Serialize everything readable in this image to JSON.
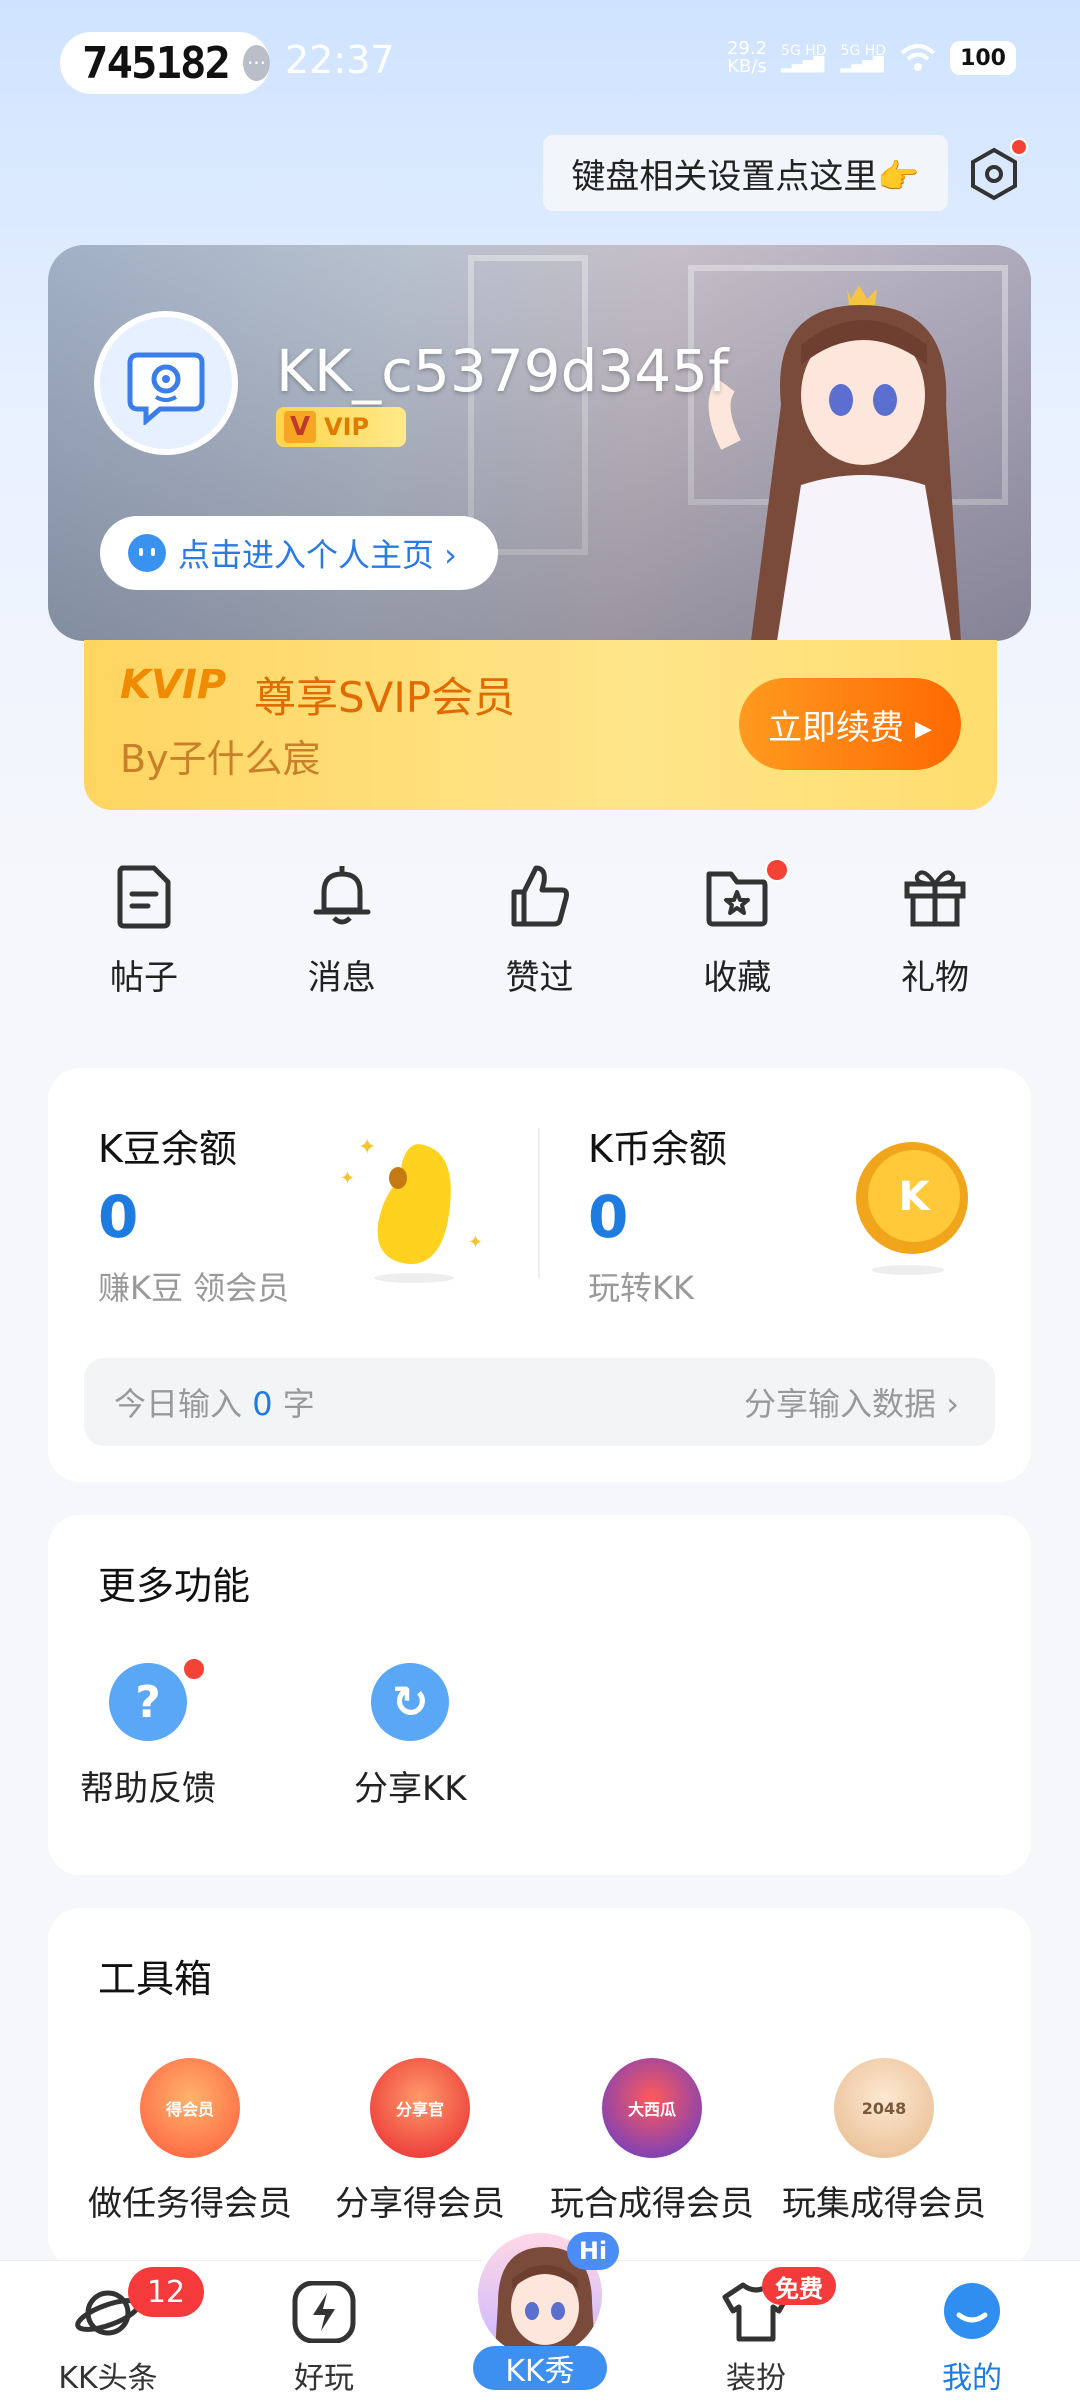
{
  "status_bar": {
    "pill_number": "745182",
    "time": "22:37",
    "net_speed": "29.2",
    "net_unit": "KB/s",
    "sim1": "5G HD",
    "sim2": "5G HD",
    "battery": "100"
  },
  "keyboard_tip": "键盘相关设置点这里👉",
  "profile": {
    "username": "KK_c5379d345f",
    "vip_badge": "VIP",
    "vip_letter": "V",
    "home_button": "点击进入个人主页 ›"
  },
  "svip_banner": {
    "brand": "KVIP",
    "title": "尊享SVIP会员",
    "subtitle": "By子什么宸",
    "renew_button": "立即续费 ▸"
  },
  "quick_actions": [
    {
      "label": "帖子",
      "icon": "post-icon"
    },
    {
      "label": "消息",
      "icon": "bell-icon"
    },
    {
      "label": "赞过",
      "icon": "thumb-up-icon"
    },
    {
      "label": "收藏",
      "icon": "favorite-folder-icon"
    },
    {
      "label": "礼物",
      "icon": "gift-icon"
    }
  ],
  "balance": {
    "kdou_title": "K豆余额",
    "kdou_value": "0",
    "kdou_sub": "赚K豆 领会员",
    "kbi_title": "K币余额",
    "kbi_value": "0",
    "kbi_sub": "玩转KK",
    "kbi_coin": "K",
    "today_prefix": "今日输入",
    "today_count": "0",
    "today_suffix": "字",
    "share_data": "分享输入数据 ›"
  },
  "more_functions": {
    "title": "更多功能",
    "items": [
      {
        "label": "帮助反馈",
        "icon": "help-icon",
        "glyph": "?"
      },
      {
        "label": "分享KK",
        "icon": "share-icon",
        "glyph": "↻"
      }
    ]
  },
  "toolbox": {
    "title": "工具箱",
    "items": [
      {
        "label": "做任务得会员",
        "icon": "task-vip-icon",
        "tag": "得会员",
        "color": "#ff7a4a"
      },
      {
        "label": "分享得会员",
        "icon": "share-vip-icon",
        "tag": "分享官",
        "color": "#ff4d4d"
      },
      {
        "label": "玩合成得会员",
        "icon": "watermelon-game-icon",
        "tag": "大西瓜",
        "color": "#7b4de0"
      },
      {
        "label": "玩集成得会员",
        "icon": "2048-game-icon",
        "tag": "2048",
        "color": "#d9a36a"
      }
    ]
  },
  "bottom_nav": {
    "items": [
      {
        "label": "KK头条",
        "icon": "planet-icon"
      },
      {
        "label": "好玩",
        "icon": "lightning-icon"
      },
      {
        "label": "装扮",
        "icon": "tshirt-icon"
      },
      {
        "label": "我的",
        "icon": "profile-bubble-icon"
      }
    ],
    "headline_badge": "12",
    "dress_badge": "免费",
    "kkshow_label": "KK秀",
    "kkshow_hi": "Hi"
  },
  "colors": {
    "accent_blue": "#1e7be0",
    "vip_orange": "#ff6a00",
    "badge_red": "#f43a3a"
  }
}
